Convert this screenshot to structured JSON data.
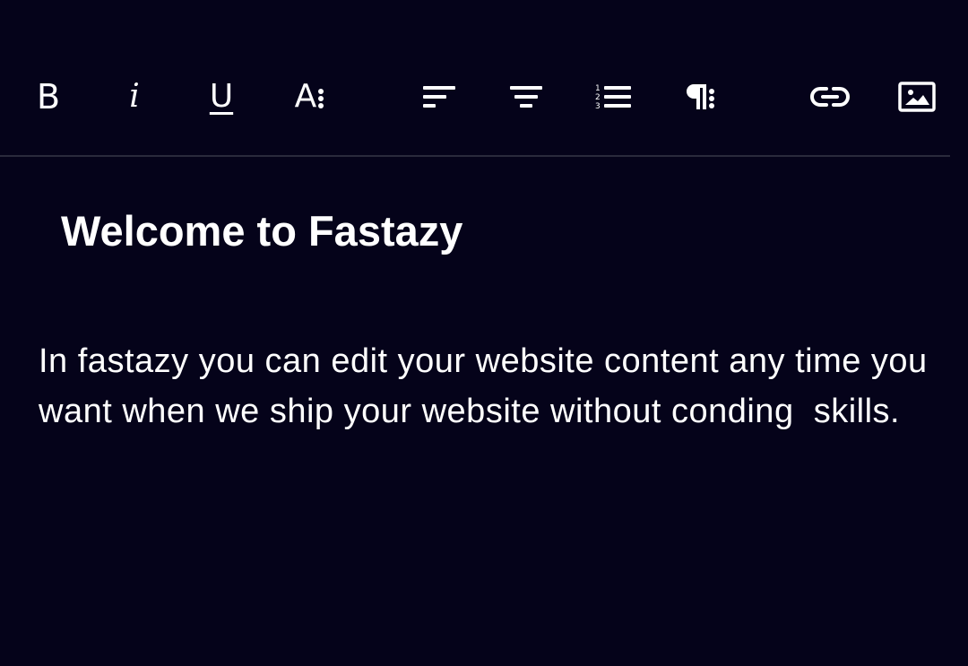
{
  "toolbar": {
    "bold_label": "B",
    "italic_label": "i",
    "underline_label": "U",
    "font_size_label": "A",
    "tools": [
      {
        "name": "bold",
        "icon": "bold-icon"
      },
      {
        "name": "italic",
        "icon": "italic-icon"
      },
      {
        "name": "underline",
        "icon": "underline-icon"
      },
      {
        "name": "font-size",
        "icon": "font-size-icon"
      },
      {
        "name": "align-left",
        "icon": "align-left-icon"
      },
      {
        "name": "align-center",
        "icon": "align-center-icon"
      },
      {
        "name": "ordered-list",
        "icon": "ordered-list-icon"
      },
      {
        "name": "paragraph",
        "icon": "paragraph-icon"
      },
      {
        "name": "link",
        "icon": "link-icon"
      },
      {
        "name": "image",
        "icon": "image-icon"
      }
    ]
  },
  "editor": {
    "heading": "Welcome to Fastazy",
    "paragraph": "In fastazy you can edit your website content any time you want when we ship your website without conding  skills."
  },
  "colors": {
    "background": "#05031a",
    "text": "#ffffff",
    "divider": "#2a2a3c"
  }
}
